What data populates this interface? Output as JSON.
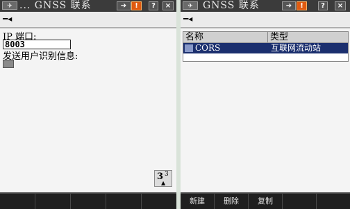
{
  "left": {
    "title": "... GNSS 联系",
    "labels": {
      "ip_port": "IP 端口:",
      "send_user_id": "发送用户识别信息:"
    },
    "ip_port_value": "8003",
    "page": {
      "current": "3",
      "total": "3"
    },
    "softkeys": [
      "",
      "",
      "",
      "",
      ""
    ]
  },
  "right": {
    "title": "GNSS 联系",
    "columns": [
      "名称",
      "类型"
    ],
    "rows": [
      {
        "name": "CORS",
        "type": "互联网流动站"
      }
    ],
    "softkeys": [
      "新建",
      "删除",
      "复制",
      "",
      ""
    ]
  },
  "titlebar": {
    "help": "?",
    "close": "×",
    "warn": "!"
  },
  "colors": {
    "titlebar": "#3b3b3b",
    "selected_row": "#1b2f6e",
    "softkey_bar": "#1f1f1f",
    "warning": "#e05a10"
  },
  "icons": [
    "app-logo-icon",
    "arrow-icon",
    "warning-icon",
    "help-icon",
    "close-icon",
    "plug-icon",
    "page-down-icon"
  ]
}
